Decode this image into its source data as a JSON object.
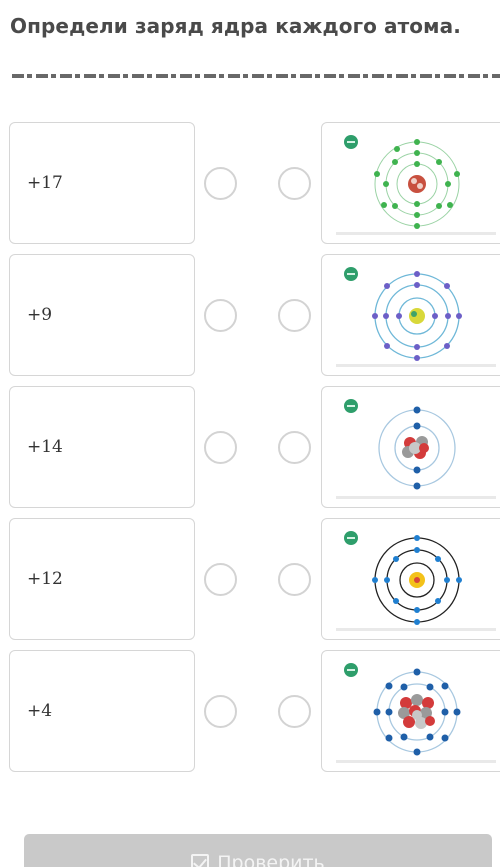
{
  "task": {
    "title": "Определи заряд ядра каждого атома."
  },
  "rows": [
    {
      "charge": "+17"
    },
    {
      "charge": "+9"
    },
    {
      "charge": "+14"
    },
    {
      "charge": "+12"
    },
    {
      "charge": "+4"
    }
  ],
  "button": {
    "label": "Проверить"
  },
  "colors": {
    "badge": "#2e9e6b",
    "electron_green": "#3fb34f",
    "electron_purple": "#6c5fc7",
    "electron_blue": "#1f5fa8",
    "button_bg": "#c9c9c9"
  }
}
